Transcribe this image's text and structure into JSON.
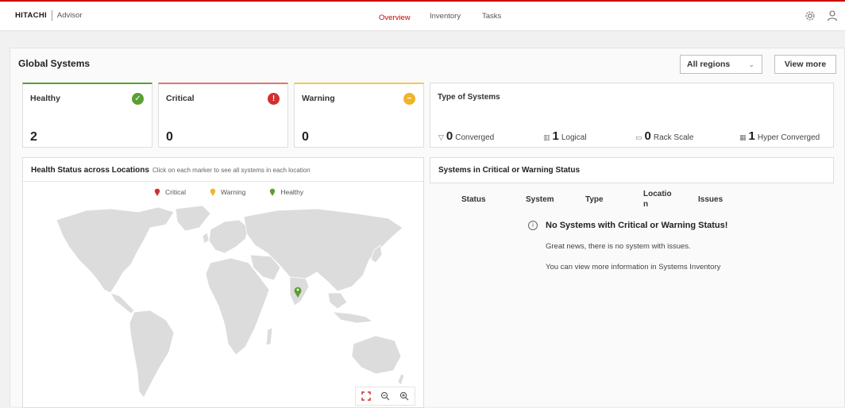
{
  "brand": {
    "logo": "HITACHI",
    "app_name": "Advisor"
  },
  "nav": {
    "tabs": [
      {
        "label": "Overview",
        "active": true
      },
      {
        "label": "Inventory",
        "active": false
      },
      {
        "label": "Tasks",
        "active": false
      }
    ]
  },
  "icons": {
    "settings": "gear-icon",
    "user": "user-icon"
  },
  "panel": {
    "title": "Global Systems",
    "region_select": "All regions",
    "view_more": "View more"
  },
  "status_cards": [
    {
      "label": "Healthy",
      "count": "2",
      "color": "#5a9f32",
      "icon": "check-circle-icon",
      "glyph": "✓"
    },
    {
      "label": "Critical",
      "count": "0",
      "color": "#d32f2f",
      "icon": "alert-circle-icon",
      "glyph": "!"
    },
    {
      "label": "Warning",
      "count": "0",
      "color": "#f0b429",
      "icon": "minus-circle-icon",
      "glyph": "−"
    }
  ],
  "types": {
    "title": "Type of Systems",
    "items": [
      {
        "count": "0",
        "label": "Converged",
        "icon": "converged-icon"
      },
      {
        "count": "1",
        "label": "Logical",
        "icon": "logical-icon"
      },
      {
        "count": "0",
        "label": "Rack Scale",
        "icon": "rack-icon"
      },
      {
        "count": "1",
        "label": "Hyper Converged",
        "icon": "hyper-converged-icon"
      }
    ]
  },
  "health_map": {
    "title": "Health Status across Locations",
    "hint": "Click on each marker to see all systems in each location",
    "legend": [
      {
        "label": "Critical",
        "color": "#d32f2f"
      },
      {
        "label": "Warning",
        "color": "#f0b429"
      },
      {
        "label": "Healthy",
        "color": "#5a9f32"
      }
    ],
    "markers": [
      {
        "status": "Healthy",
        "region": "India"
      }
    ]
  },
  "critical_table": {
    "title": "Systems in Critical or Warning Status",
    "columns": [
      "Status",
      "System",
      "Type",
      "Locatio\nn",
      "Issues"
    ],
    "empty_title": "No Systems with Critical or Warning Status!",
    "empty_line1": "Great news, there is no system with issues.",
    "empty_line2": "You can view more information in Systems Inventory"
  }
}
